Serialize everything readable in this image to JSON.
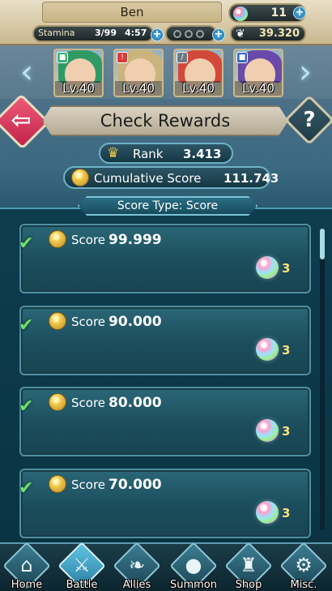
{
  "status": {
    "player_name": "Ben",
    "orbs": "11",
    "stamina_label": "Stamina",
    "stamina_value": "3/99",
    "stamina_timer": "4:57",
    "feathers": "39.320",
    "plus_symbol": "+"
  },
  "team": [
    {
      "level": "Lv.40",
      "badge_icon": "green-square-icon",
      "hair_color": "#2f9a64"
    },
    {
      "level": "Lv.40",
      "badge_icon": "red-warning-icon",
      "hair_color": "#c9b47e"
    },
    {
      "level": "Lv.40",
      "badge_icon": "sword-icon",
      "hair_color": "#d2493a"
    },
    {
      "level": "Lv.40",
      "badge_icon": "blue-square-icon",
      "hair_color": "#6a4aa8"
    }
  ],
  "header": {
    "title": "Check Rewards",
    "help_label": "?"
  },
  "rank": {
    "label": "Rank",
    "value": "3.413"
  },
  "cumulative": {
    "label": "Cumulative Score",
    "value": "111.743"
  },
  "score_type": "Score Type: Score",
  "rewards": [
    {
      "label": "Score",
      "value": "99.999",
      "reward_count": "3",
      "claimed": true
    },
    {
      "label": "Score",
      "value": "90.000",
      "reward_count": "3",
      "claimed": true
    },
    {
      "label": "Score",
      "value": "80.000",
      "reward_count": "3",
      "claimed": true
    },
    {
      "label": "Score",
      "value": "70.000",
      "reward_count": "3",
      "claimed": true
    }
  ],
  "nav": [
    {
      "label": "Home",
      "icon": "home-icon"
    },
    {
      "label": "Battle",
      "icon": "swords-icon",
      "active": true
    },
    {
      "label": "Allies",
      "icon": "wings-icon"
    },
    {
      "label": "Summon",
      "icon": "orb-icon"
    },
    {
      "label": "Shop",
      "icon": "castle-icon"
    },
    {
      "label": "Misc.",
      "icon": "gear-icon"
    }
  ],
  "colors": {
    "accent": "#4fb5e8",
    "check": "#6fe06a",
    "back_button": "#e0355e"
  }
}
